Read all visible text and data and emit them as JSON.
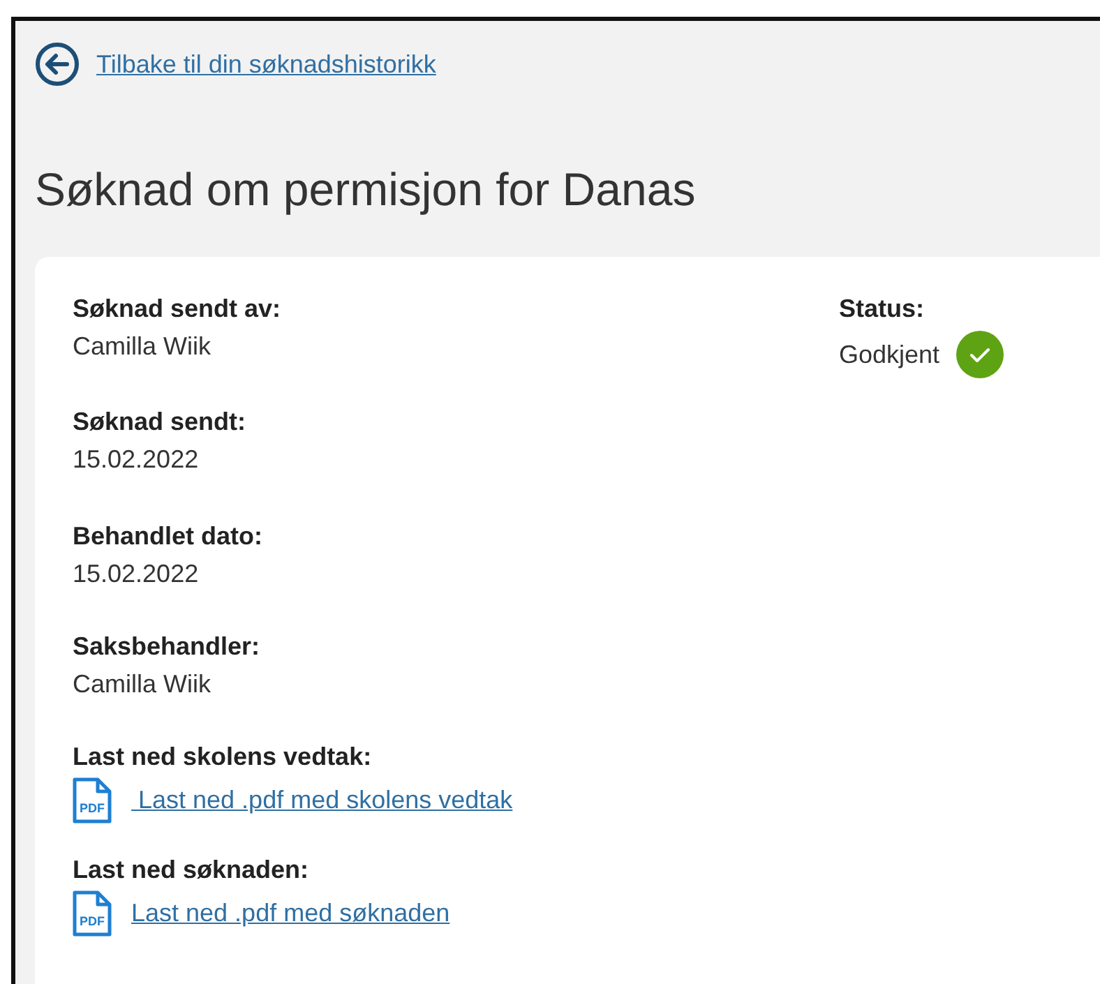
{
  "back_link": {
    "label": "Tilbake til din søknadshistorikk"
  },
  "title": "Søknad om permisjon for Danas",
  "fields": [
    {
      "kind": "text",
      "label": "Søknad sendt av:",
      "value": "Camilla Wiik"
    },
    {
      "kind": "text",
      "label": "Søknad sendt:",
      "value": "15.02.2022"
    },
    {
      "kind": "text",
      "label": "Behandlet dato:",
      "value": "15.02.2022"
    },
    {
      "kind": "text",
      "label": "Saksbehandler:",
      "value": "Camilla Wiik"
    },
    {
      "kind": "pdf",
      "label": "Last ned skolens vedtak:",
      "value": " Last ned .pdf med skolens vedtak",
      "icon_text": "PDF"
    },
    {
      "kind": "pdf",
      "label": "Last ned søknaden:",
      "value": "Last ned .pdf med søknaden",
      "icon_text": "PDF"
    }
  ],
  "status": {
    "label": "Status:",
    "value": "Godkjent",
    "approved": true
  }
}
